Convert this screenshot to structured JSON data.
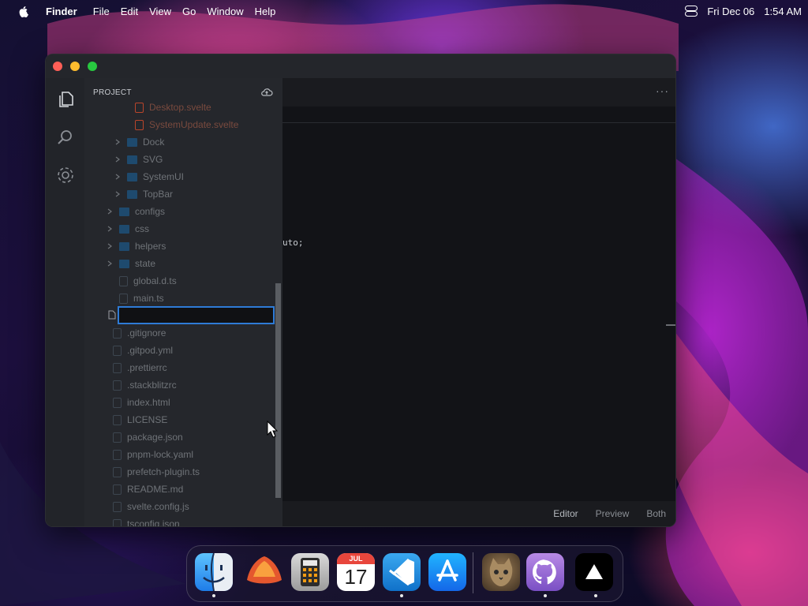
{
  "menubar": {
    "app": "Finder",
    "items": [
      "File",
      "Edit",
      "View",
      "Go",
      "Window",
      "Help"
    ],
    "date": "Fri Dec 06",
    "time": "1:54 AM"
  },
  "window": {
    "sidebar_title": "PROJECT",
    "tree": [
      {
        "label": "Desktop.svelte",
        "icon": "svelte-icon",
        "color": "#b9452b"
      },
      {
        "label": "SystemUpdate.svelte",
        "icon": "svelte-icon",
        "color": "#b9452b"
      },
      {
        "label": "Dock",
        "icon": "folder-icon"
      },
      {
        "label": "SVG",
        "icon": "folder-icon"
      },
      {
        "label": "SystemUI",
        "icon": "folder-icon"
      },
      {
        "label": "TopBar",
        "icon": "folder-icon"
      },
      {
        "label": "configs",
        "icon": "folder-icon"
      },
      {
        "label": "css",
        "icon": "folder-icon"
      },
      {
        "label": "helpers",
        "icon": "folder-icon"
      },
      {
        "label": "state",
        "icon": "folder-icon"
      },
      {
        "label": "global.d.ts",
        "icon": "typescript-def-icon"
      },
      {
        "label": "main.ts",
        "icon": "typescript-icon"
      },
      {
        "label": "",
        "icon": "file-icon"
      },
      {
        "label": ".gitignore",
        "icon": "git-icon"
      },
      {
        "label": ".gitpod.yml",
        "icon": "yaml-icon"
      },
      {
        "label": ".prettierrc",
        "icon": "prettier-icon"
      },
      {
        "label": ".stackblitzrc",
        "icon": "stackblitz-icon"
      },
      {
        "label": "index.html",
        "icon": "html-icon"
      },
      {
        "label": "LICENSE",
        "icon": "license-icon"
      },
      {
        "label": "package.json",
        "icon": "json-icon"
      },
      {
        "label": "pnpm-lock.yaml",
        "icon": "pnpm-icon"
      },
      {
        "label": "prefetch-plugin.ts",
        "icon": "typescript-icon"
      },
      {
        "label": "README.md",
        "icon": "info-icon"
      },
      {
        "label": "svelte.config.js",
        "icon": "gear-icon"
      },
      {
        "label": "tsconfig.json",
        "icon": "json-icon"
      }
    ],
    "code_fragment": "uto;",
    "view_tabs": [
      "Editor",
      "Preview",
      "Both"
    ],
    "more_label": "···"
  },
  "dock": {
    "apps": [
      {
        "name": "Finder",
        "running": true
      },
      {
        "name": "Safari",
        "running": false
      },
      {
        "name": "Calculator",
        "running": false
      },
      {
        "name": "Calendar",
        "running": false,
        "month": "JUL",
        "day": "17"
      },
      {
        "name": "VS Code",
        "running": true
      },
      {
        "name": "App Store",
        "running": false
      },
      {
        "name": "Purrfect",
        "running": false
      },
      {
        "name": "GitHub",
        "running": true
      },
      {
        "name": "Vercel",
        "running": true
      }
    ]
  }
}
